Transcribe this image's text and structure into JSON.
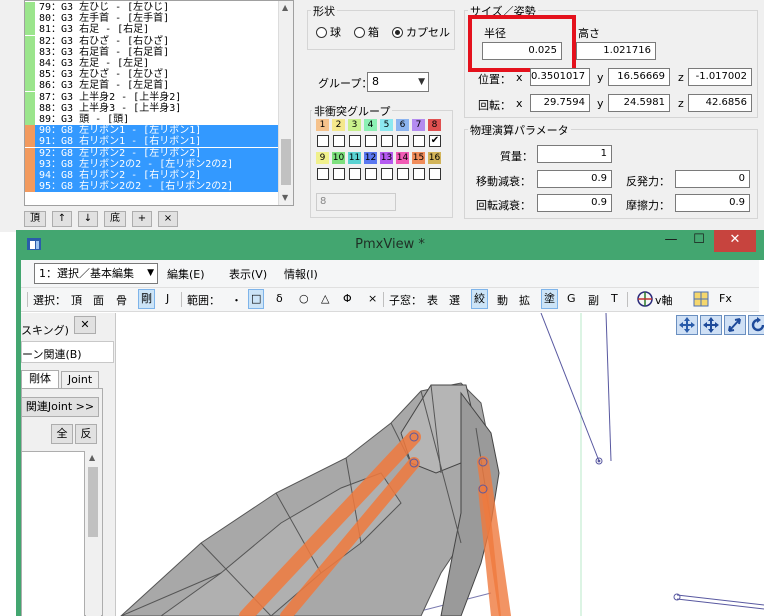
{
  "bone_list": {
    "rows": [
      {
        "text": "79：G3  左ひじ - [左ひじ]",
        "marker": "#9be58c",
        "selected": false
      },
      {
        "text": "80：G3  左手首 - [左手首]",
        "marker": "#9be58c",
        "selected": false
      },
      {
        "text": "81：G3  右足 - [右足]",
        "marker": "#9be58c",
        "selected": false
      },
      {
        "text": "82：G3  右ひざ - [右ひざ]",
        "marker": "#9be58c",
        "selected": false
      },
      {
        "text": "83：G3  右足首 - [右足首]",
        "marker": "#9be58c",
        "selected": false
      },
      {
        "text": "84：G3  左足 - [左足]",
        "marker": "#9be58c",
        "selected": false
      },
      {
        "text": "85：G3  左ひざ - [左ひざ]",
        "marker": "#9be58c",
        "selected": false
      },
      {
        "text": "86：G3  左足首 - [左足首]",
        "marker": "#9be58c",
        "selected": false
      },
      {
        "text": "87：G3  上半身2 - [上半身2]",
        "marker": "#9be58c",
        "selected": false
      },
      {
        "text": "88：G3  上半身3 - [上半身3]",
        "marker": "#9be58c",
        "selected": false
      },
      {
        "text": "89：G3  頭 - [頭]",
        "marker": "#9be58c",
        "selected": false
      },
      {
        "text": "90：G8  左リボン1 - [左リボン1]",
        "marker": "#f29a5e",
        "selected": true
      },
      {
        "text": "91：G8  右リボン1 - [右リボン1]",
        "marker": "#f29a5e",
        "selected": true
      },
      {
        "text": "92：G8  左リボン2 - [左リボン2]",
        "marker": "#f29a5e",
        "selected": true
      },
      {
        "text": "93：G8  左リボン2の2 - [左リボン2の2]",
        "marker": "#f29a5e",
        "selected": true
      },
      {
        "text": "94：G8  右リボン2 - [右リボン2]",
        "marker": "#f29a5e",
        "selected": true
      },
      {
        "text": "95：G8  右リボン2の2 - [右リボン2の2]",
        "marker": "#f29a5e",
        "selected": true
      }
    ],
    "toolbar": [
      "頂",
      "↑",
      "↓",
      "底",
      "+",
      "×"
    ]
  },
  "shape": {
    "title": "形状",
    "options": [
      "球",
      "箱",
      "カプセル"
    ],
    "selected": "カプセル"
  },
  "group": {
    "label": "グループ：",
    "value": "8"
  },
  "noncollision": {
    "title": "非衝突グループ",
    "numbers": [
      "1",
      "2",
      "3",
      "4",
      "5",
      "6",
      "7",
      "8",
      "9",
      "10",
      "11",
      "12",
      "13",
      "14",
      "15",
      "16"
    ],
    "colors": [
      "#f5c28c",
      "#f5e88c",
      "#c8f08c",
      "#8cf0b4",
      "#8ce8f0",
      "#8cb4f0",
      "#b48cf0",
      "#e05050",
      "#f0f08c",
      "#7ee07e",
      "#5ad2d2",
      "#5a78f0",
      "#b45af0",
      "#f05ab4",
      "#f08c5a",
      "#d2b45a"
    ],
    "checked_index": 7,
    "mask_value": "8"
  },
  "size": {
    "title": "サイズ／姿勢",
    "radius_label": "半径",
    "radius": "0.025",
    "height_label": "高さ",
    "height": "1.021716",
    "position_label": "位置：",
    "position": {
      "x": "0.3501017",
      "y": "16.56669",
      "z": "-1.017002"
    },
    "rotation_label": "回転：",
    "rotation": {
      "x": "29.7594",
      "y": "24.5981",
      "z": "42.6856"
    },
    "axis_x": "x",
    "axis_y": "y",
    "axis_z": "z"
  },
  "physics": {
    "title": "物理演算パラメータ",
    "mass_label": "質量：",
    "mass": "1",
    "move_damp_label": "移動減衰：",
    "move_damp": "0.9",
    "rot_damp_label": "回転減衰：",
    "rot_damp": "0.9",
    "restitution_label": "反発力：",
    "restitution": "0",
    "friction_label": "摩擦力：",
    "friction": "0.9"
  },
  "window": {
    "title": "PmxView *",
    "minimize": "—",
    "maximize": "☐",
    "close": "✕",
    "mode": "1：選択／基本編集",
    "menus": [
      "編集(E)",
      "表示(V)",
      "情報(I)"
    ],
    "toolbar": {
      "select_label": "選択：",
      "select_items": [
        "頂",
        "面",
        "骨",
        "剛",
        "J"
      ],
      "range_label": "範囲：",
      "range_items": [
        "・",
        "□",
        "δ",
        "○",
        "△",
        "Φ",
        "×"
      ],
      "subwin_label": "子窓：",
      "subwin_items": [
        "表",
        "選",
        "絞",
        "動",
        "拡",
        "塗",
        "G",
        "副",
        "T"
      ],
      "vaxis": "v軸",
      "fx": "Fx"
    }
  },
  "sub_panel": {
    "title_fragment": "スキング)",
    "close": "✕",
    "bone_related": "ーン関連(B)",
    "tabs": [
      "剛体",
      "Joint"
    ],
    "related_joint": "関連Joint >>",
    "all": "全",
    "invert": "反"
  },
  "colors": {
    "selection": "#3399ff",
    "window_frame": "#43a670",
    "highlight": "#e4111c",
    "rigid_body": "#f07a3e",
    "mesh": "#9e9e9e"
  }
}
